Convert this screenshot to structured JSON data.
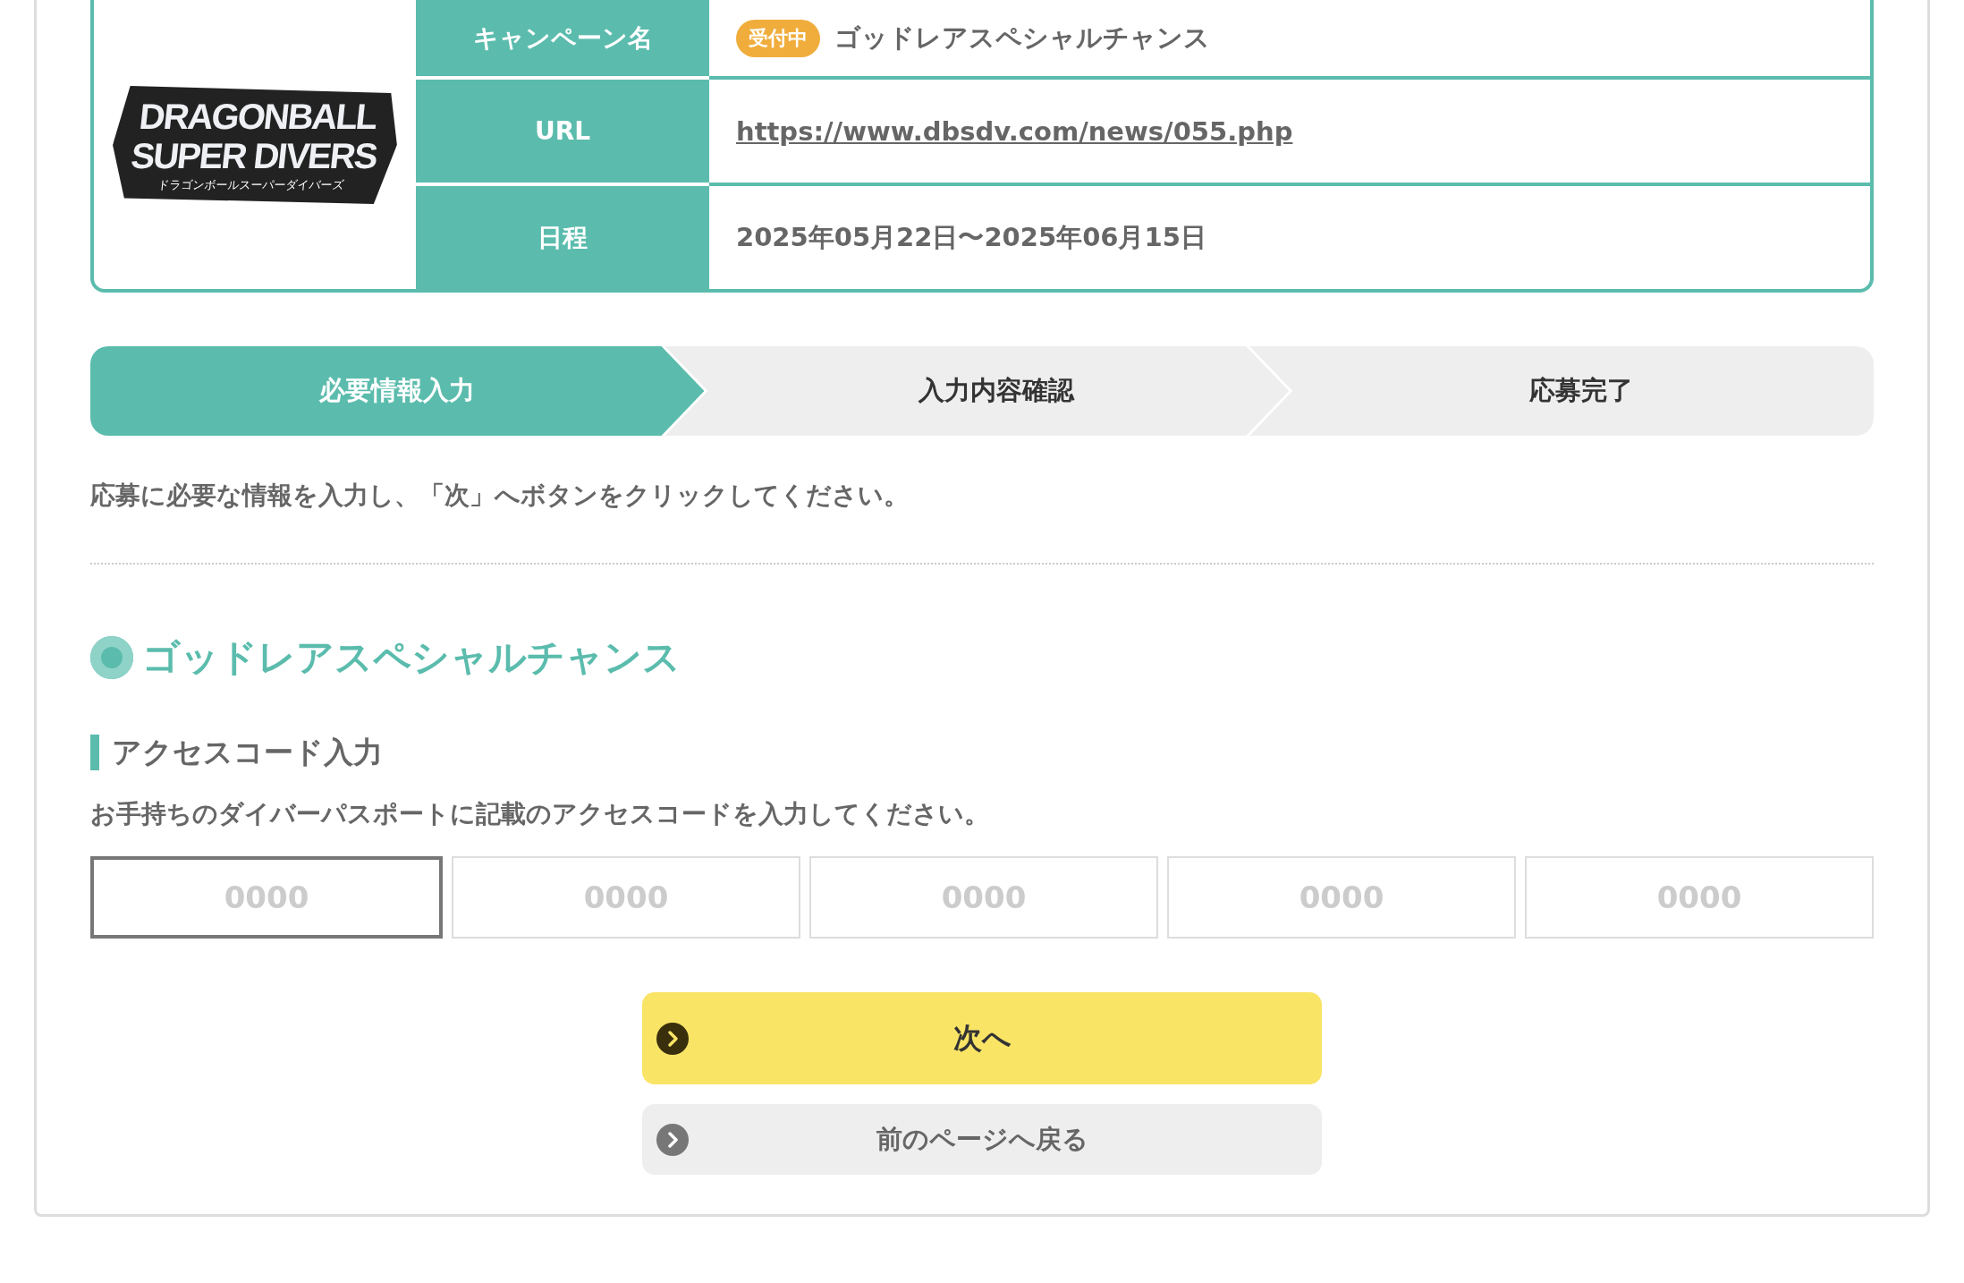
{
  "campaign_info": {
    "logo": {
      "line_1": "DRAGONBALL",
      "line_2": "SUPER DIVERS",
      "subtitle": "ドラゴンボールスーパーダイバーズ"
    },
    "rows": [
      {
        "label": "キャンペーン名",
        "kind": "name",
        "badge": "受付中",
        "value": "ゴッドレアスペシャルチャンス"
      },
      {
        "label": "URL",
        "kind": "link",
        "value": "https://www.dbsdv.com/news/055.php"
      },
      {
        "label": "日程",
        "kind": "text",
        "value": "2025年05月22日〜2025年06月15日"
      }
    ]
  },
  "steps": [
    {
      "label": "必要情報入力",
      "selected": true
    },
    {
      "label": "入力内容確認",
      "selected": false
    },
    {
      "label": "応募完了",
      "selected": false
    }
  ],
  "instruction": "応募に必要な情報を入力し、「次」へボタンをクリックしてください。",
  "section_title": "ゴッドレアスペシャルチャンス",
  "access_code": {
    "heading": "アクセスコード入力",
    "description": "お手持ちのダイバーパスポートに記載のアクセスコードを入力してください。",
    "fields": [
      {
        "placeholder": "0000",
        "focused": true
      },
      {
        "placeholder": "0000",
        "focused": false
      },
      {
        "placeholder": "0000",
        "focused": false
      },
      {
        "placeholder": "0000",
        "focused": false
      },
      {
        "placeholder": "0000",
        "focused": false
      }
    ]
  },
  "buttons": [
    {
      "label": "次へ",
      "kind": "primary"
    },
    {
      "label": "前のページへ戻る",
      "kind": "secondary"
    }
  ]
}
